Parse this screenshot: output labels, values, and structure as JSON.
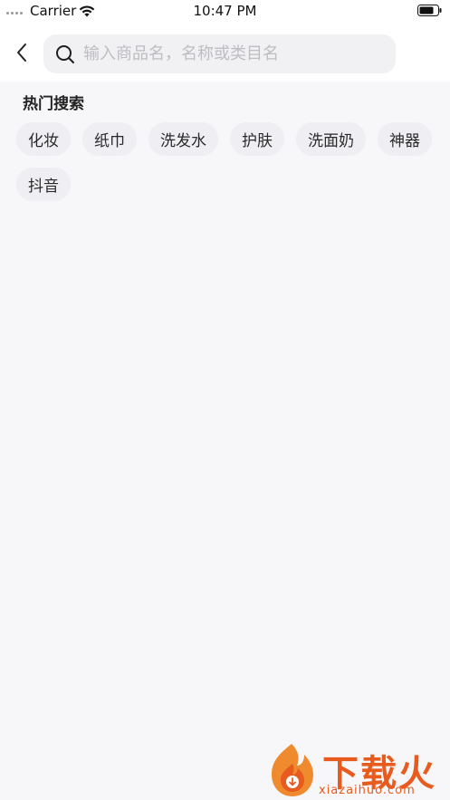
{
  "status_bar": {
    "carrier": "Carrier",
    "time": "10:47 PM"
  },
  "search": {
    "placeholder": "输入商品名，名称或类目名",
    "value": ""
  },
  "hot_search": {
    "title": "热门搜索",
    "tags": [
      "化妆",
      "纸巾",
      "洗发水",
      "护肤",
      "洗面奶",
      "神器",
      "抖音"
    ]
  },
  "watermark": {
    "brand": "下载火",
    "domain": "xiazaihuo.com"
  },
  "colors": {
    "background": "#f7f7f9",
    "tag_background": "#efeff3",
    "search_background": "#f1f1f3",
    "watermark": "#e85b1f"
  }
}
